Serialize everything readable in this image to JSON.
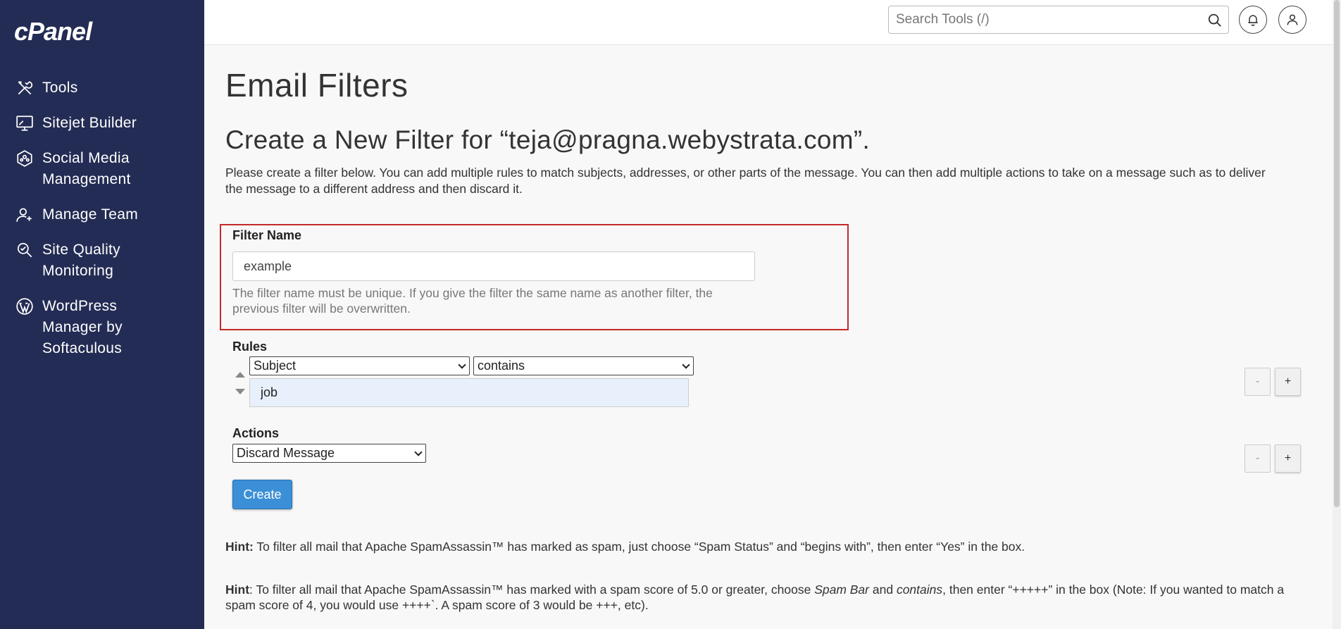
{
  "sidebar": {
    "logo": "cPanel",
    "items": [
      {
        "label": "Tools",
        "icon": "tools-icon"
      },
      {
        "label": "Sitejet Builder",
        "icon": "monitor-icon"
      },
      {
        "label": "Social Media Management",
        "icon": "social-icon"
      },
      {
        "label": "Manage Team",
        "icon": "user-plus-icon"
      },
      {
        "label": "Site Quality Monitoring",
        "icon": "magnifier-icon"
      },
      {
        "label": "WordPress Manager by Softaculous",
        "icon": "wordpress-icon"
      }
    ]
  },
  "topbar": {
    "search_placeholder": "Search Tools (/)"
  },
  "page": {
    "title": "Email Filters",
    "subtitle": "Create a New Filter for “teja@pragna.webystrata.com”.",
    "intro": "Please create a filter below. You can add multiple rules to match subjects, addresses, or other parts of the message. You can then add multiple actions to take on a message such as to deliver the message to a different address and then discard it."
  },
  "filter": {
    "label": "Filter Name",
    "value": "example",
    "help": "The filter name must be unique. If you give the filter the same name as another filter, the previous filter will be overwritten."
  },
  "rules": {
    "label": "Rules",
    "field": "Subject",
    "operator": "contains",
    "value": "job",
    "minus": "-",
    "plus": "+"
  },
  "actions": {
    "label": "Actions",
    "action": "Discard Message",
    "minus": "-",
    "plus": "+"
  },
  "create_label": "Create",
  "hints": {
    "hint_label": "Hint:",
    "hint1": " To filter all mail that Apache SpamAssassin™ has marked as spam, just choose “Spam Status” and “begins with”, then enter “Yes” in the box.",
    "hint2_label": "Hint",
    "hint2_a": ": To filter all mail that Apache SpamAssassin™ has marked with a spam score of 5.0 or greater, choose ",
    "hint2_spambar": "Spam Bar",
    "hint2_and": " and ",
    "hint2_contains": "contains",
    "hint2_b": ", then enter “+++++” in the box (Note: If you wanted to match a spam score of 4, you would use ++++`. A spam score of 3 would be +++, etc)."
  }
}
